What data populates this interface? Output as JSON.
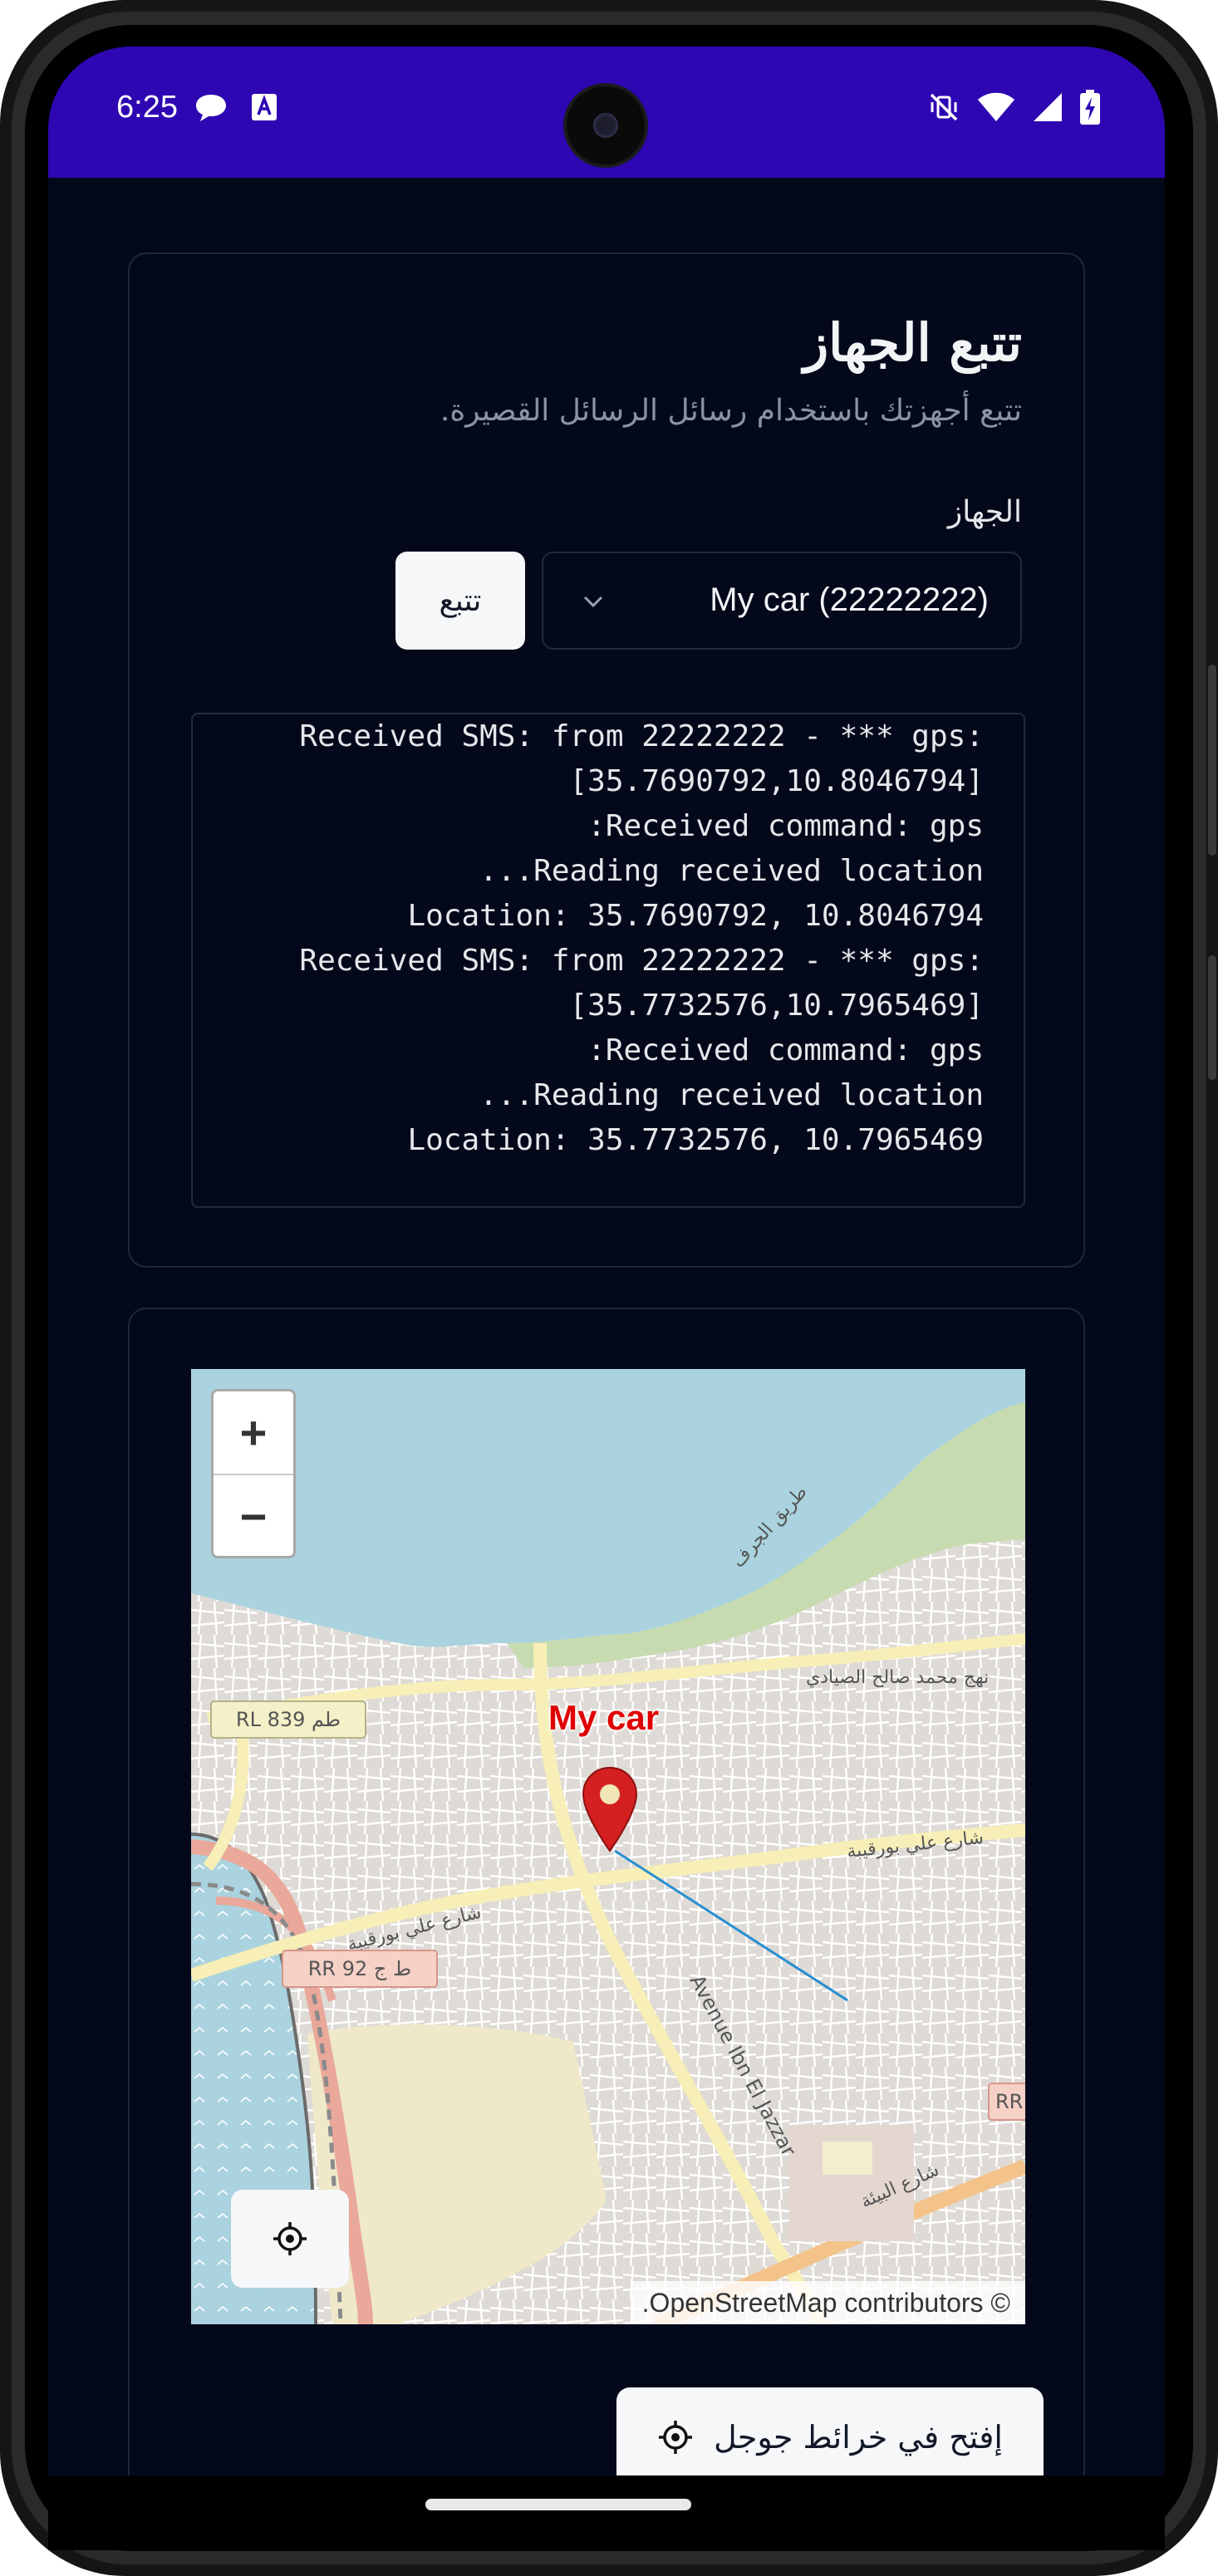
{
  "status_bar": {
    "time": "6:25",
    "background": "#2e07b3",
    "left_icons": [
      "chat-bubble-icon",
      "a-box-icon"
    ],
    "right_icons": [
      "muted-vibrate-icon",
      "wifi-icon",
      "signal-icon",
      "battery-charging-icon"
    ]
  },
  "tracking_card": {
    "title": "تتبع الجهاز",
    "subtitle": "تتبع أجهزتك باستخدام رسائل الرسائل القصيرة.",
    "device_label": "الجهاز",
    "selected_device": "My car (22222222)",
    "track_button": "تتبع",
    "log_lines": [
      "Received SMS: from 22222222 - *** gps:",
      "[35.7690792,10.8046794]",
      ":Received command: gps",
      "...Reading received location",
      "Location: 35.7690792, 10.8046794",
      "Received SMS: from 22222222 - *** gps:",
      "[35.7732576,10.7965469]",
      ":Received command: gps",
      "...Reading received location",
      "Location: 35.7732576, 10.7965469"
    ]
  },
  "map_card": {
    "zoom_in": "+",
    "zoom_out": "−",
    "marker_label": "My car",
    "attribution": ".OpenStreetMap contributors ©",
    "map_labels": {
      "road_coast": "طريق الجرف",
      "road_saleh": "نهج محمد صالح الصيادي",
      "road_ali_east": "شارع علي بورقيبة",
      "road_ali_west": "شارع علي بورقيبة",
      "avenue": "Avenue Ibn El Jazzar",
      "road_bia": "شارع البيئة",
      "rl839": "RL 839 طم",
      "rr92": "RR 92 ط ج",
      "rr_edge": "RR"
    },
    "open_google_maps_button": "إفتح في خرائط جوجل",
    "open_google_maps_icon": "locate-icon"
  },
  "colors": {
    "page_background": "#03091a",
    "card_border": "#1f2838",
    "marker": "#d42020",
    "route_line": "#2a8fd1"
  }
}
